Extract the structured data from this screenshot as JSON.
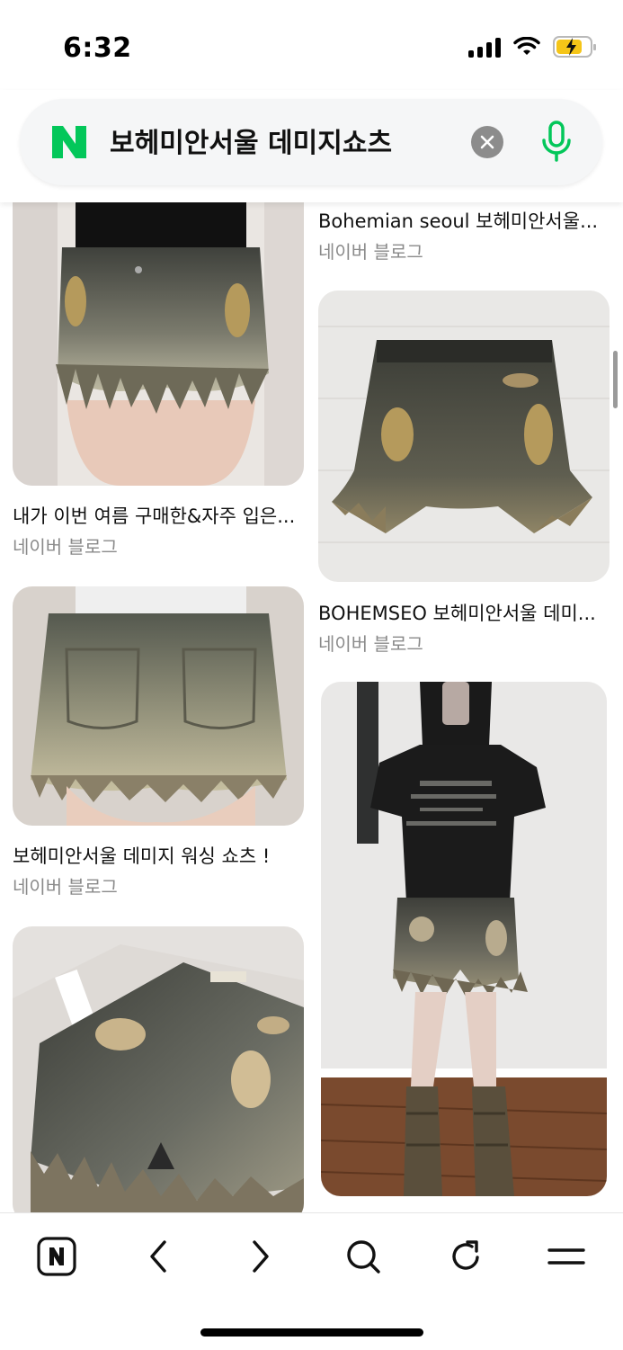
{
  "status_bar": {
    "time": "6:32"
  },
  "search": {
    "query": "보헤미안서울 데미지쇼츠",
    "logo": "N"
  },
  "results": {
    "left": [
      {
        "title": "내가 이번 여름 구매한&자주 입은...",
        "source": "네이버 블로그"
      },
      {
        "title": "보헤미안서울 데미지 워싱 쇼츠 !",
        "source": "네이버 블로그"
      },
      {
        "title": "",
        "source": ""
      }
    ],
    "right": [
      {
        "title": "Bohemian seoul 보헤미안서울...",
        "source": "네이버 블로그"
      },
      {
        "title": "BOHEMSEO 보헤미안서울 데미...",
        "source": "네이버 블로그"
      },
      {
        "title": "",
        "source": ""
      }
    ]
  },
  "toolbar": {
    "items": [
      "naver-home-icon",
      "back-icon",
      "forward-icon",
      "search-icon",
      "refresh-icon",
      "menu-icon"
    ]
  },
  "colors": {
    "naver_green": "#03c75a",
    "denim_dark": "#4a4d44",
    "denim_light": "#b8b29a",
    "ochre": "#b59a5c"
  }
}
